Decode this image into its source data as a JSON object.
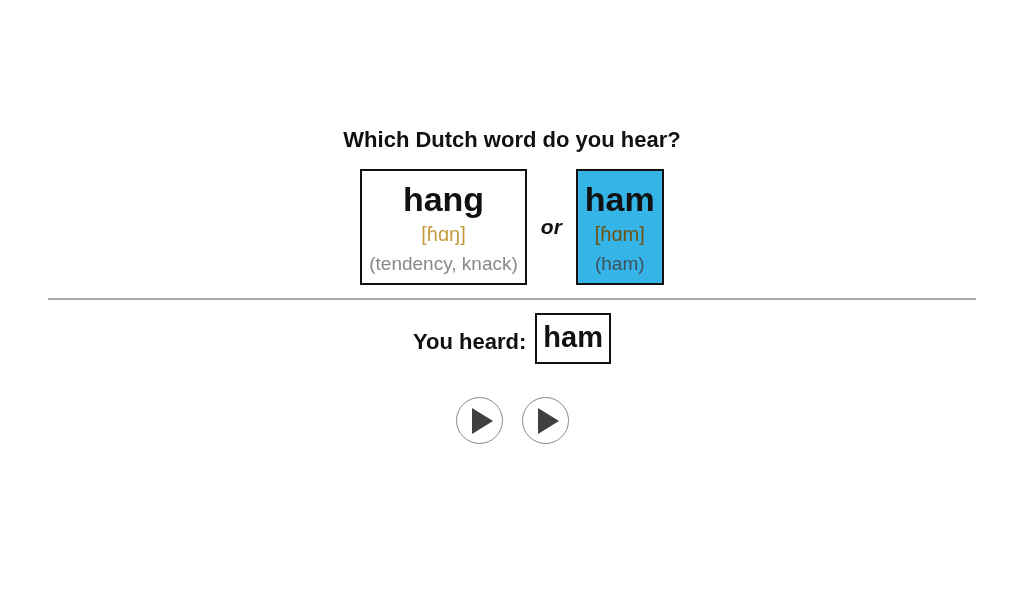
{
  "question": "Which Dutch word do you hear?",
  "options": [
    {
      "word": "hang",
      "ipa": "[ɦɑŋ]",
      "meaning": "(tendency, knack)",
      "selected": false
    },
    {
      "word": "ham",
      "ipa": "[ɦɑm]",
      "meaning": "(ham)",
      "selected": true
    }
  ],
  "separator": "or",
  "answer": {
    "label": "You heard:",
    "word": "ham"
  },
  "play_buttons": [
    {
      "kind": "play"
    },
    {
      "kind": "play"
    }
  ]
}
